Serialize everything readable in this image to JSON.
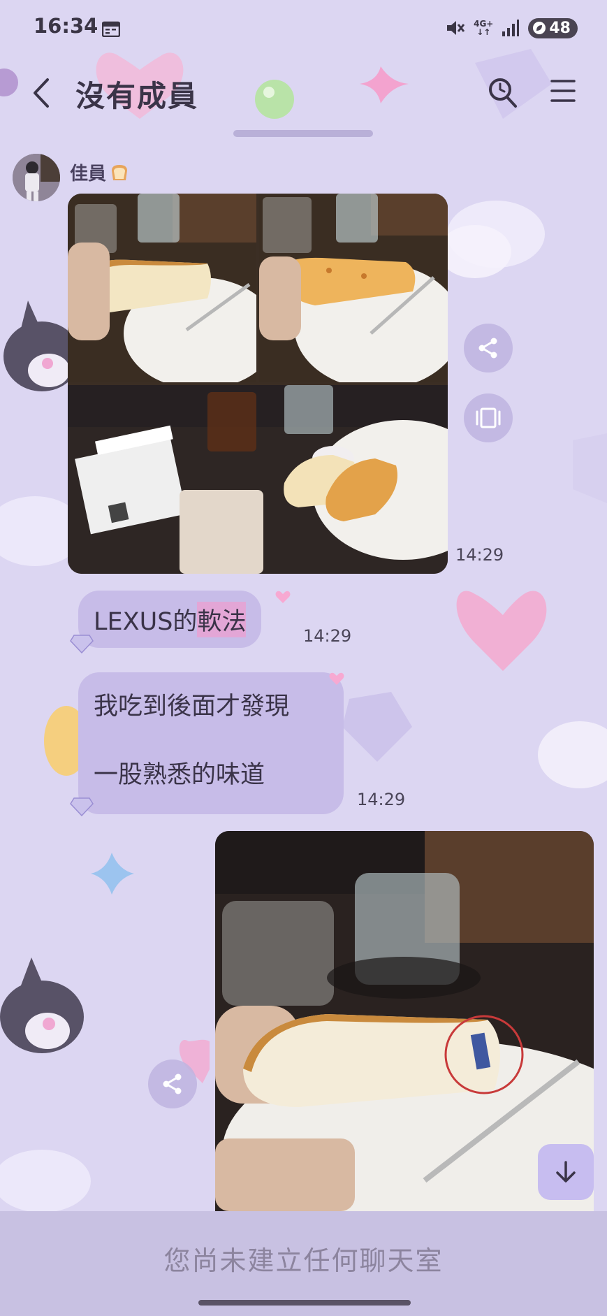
{
  "status": {
    "time": "16:34",
    "network": "4G+",
    "battery": "48"
  },
  "header": {
    "title": "沒有成員"
  },
  "chat": {
    "sender_name": "佳員",
    "messages": [
      {
        "type": "photos",
        "time": "14:29"
      },
      {
        "type": "text",
        "text_plain": "LEXUS的",
        "text_highlight": "軟法",
        "time": "14:29"
      },
      {
        "type": "text",
        "line1": "我吃到後面才發現",
        "line2": "一股熟悉的味道",
        "time": "14:29"
      },
      {
        "type": "photo"
      }
    ]
  },
  "input": {
    "placeholder": "您尚未建立任何聊天室"
  },
  "icons": {
    "back": "chevron-left-icon",
    "search": "search-icon",
    "menu": "menu-icon",
    "share": "share-icon",
    "collage": "collage-icon",
    "scroll_down": "arrow-down-icon"
  },
  "colors": {
    "background": "#dcd6f2",
    "bubble": "#c7bce8",
    "highlight": "#e3a6d6",
    "input_bar": "#c8c1e2"
  }
}
